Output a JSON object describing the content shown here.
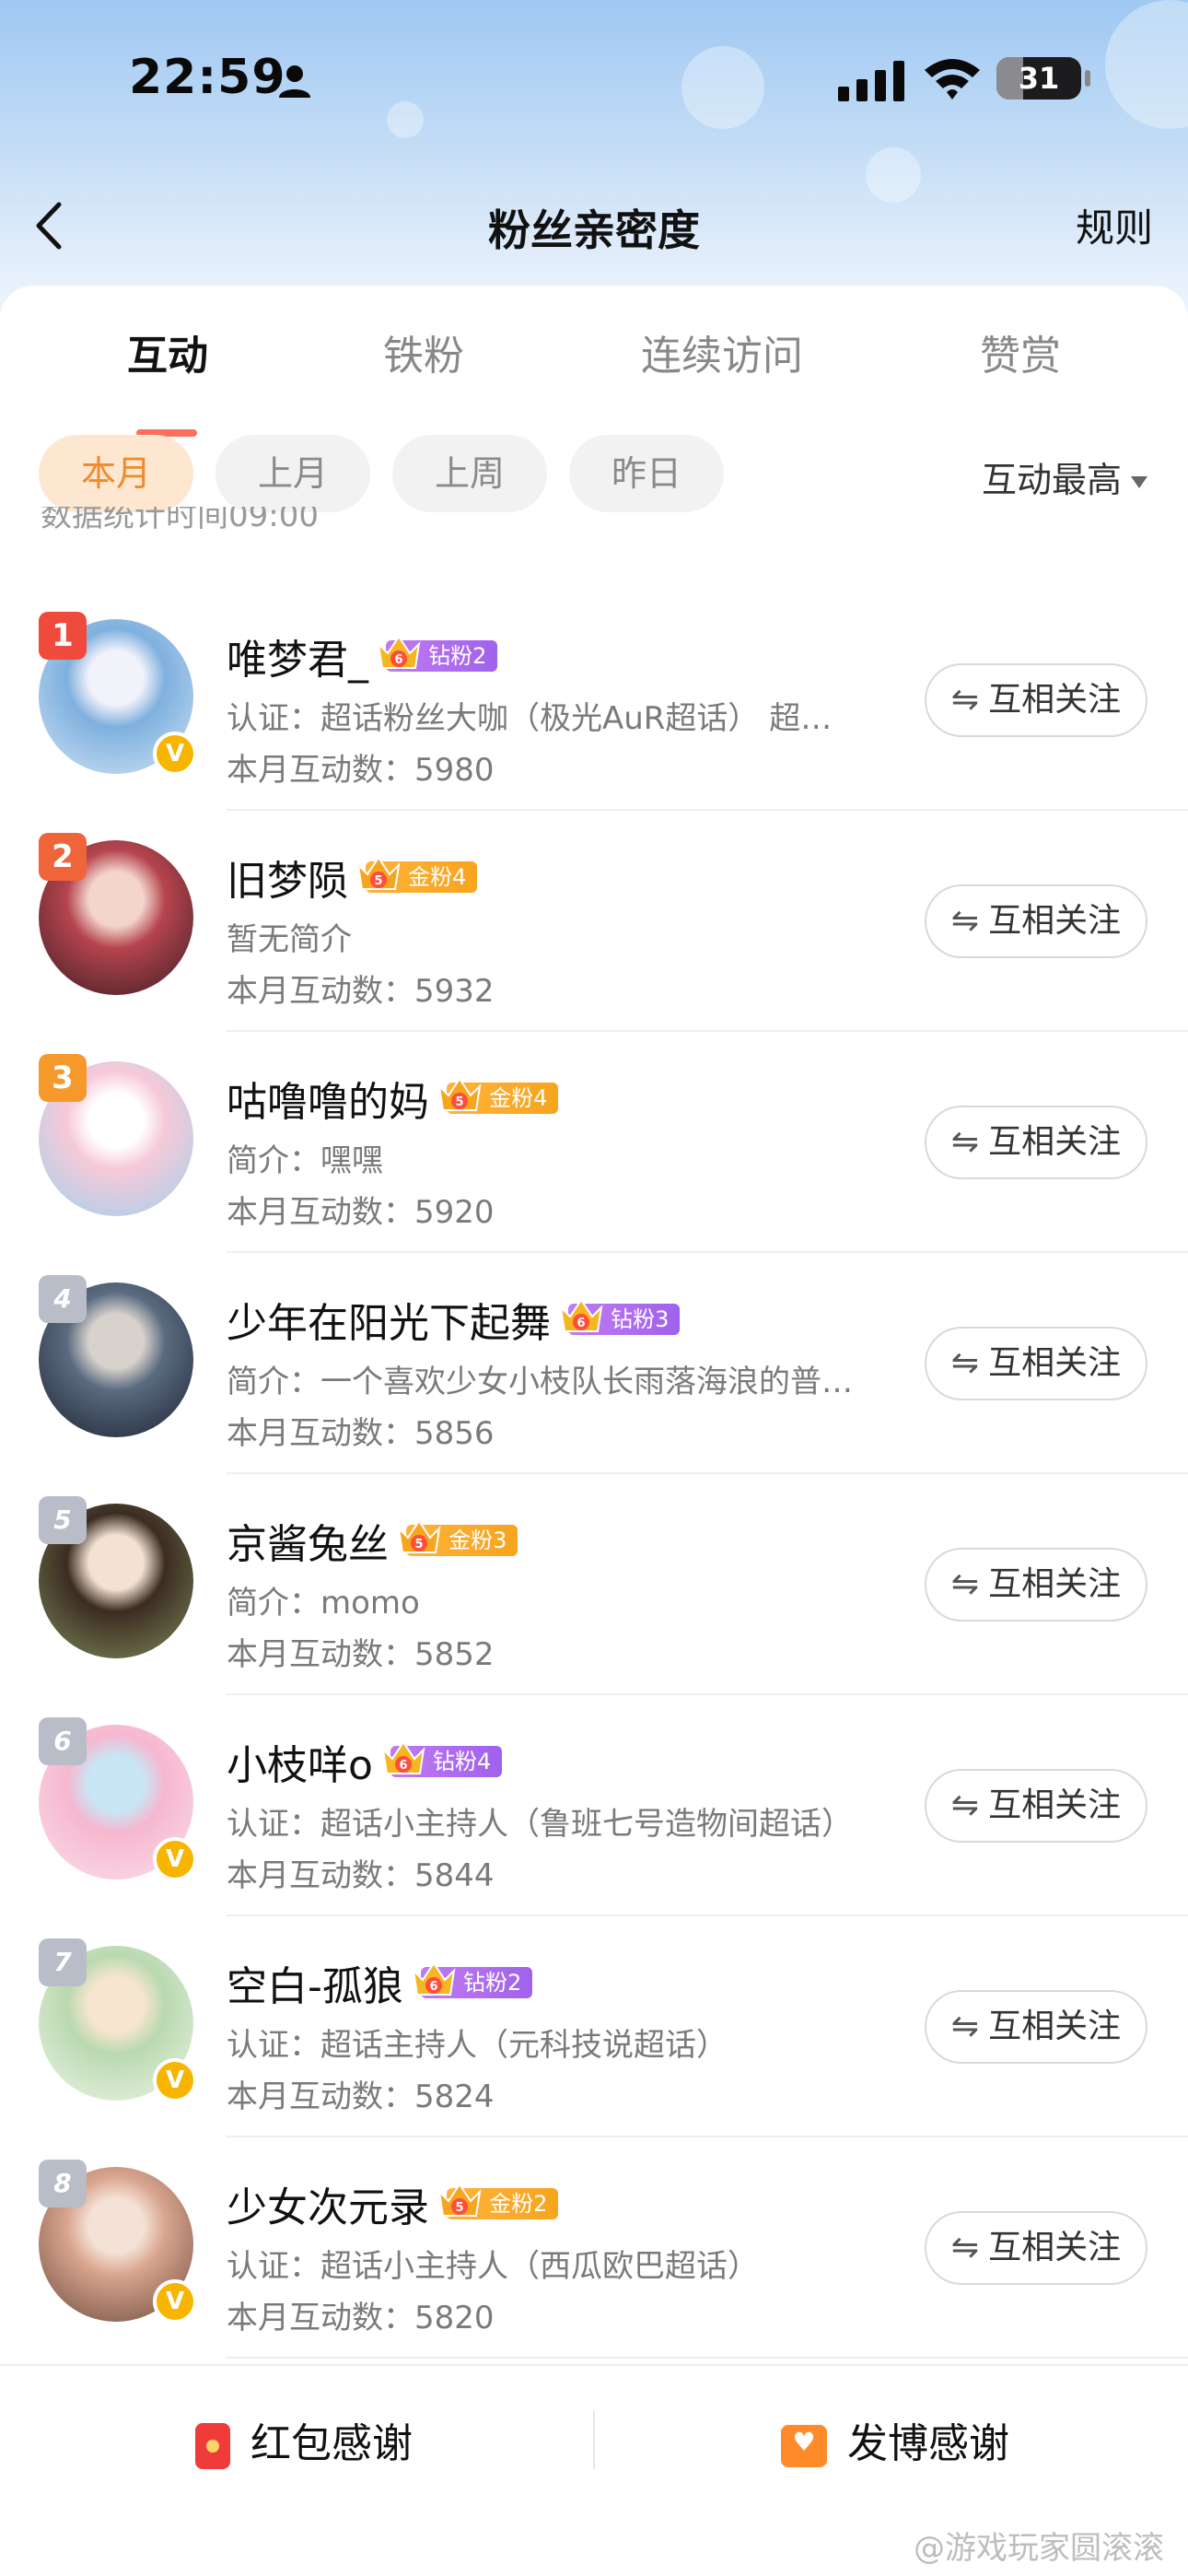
{
  "status": {
    "time": "22:59",
    "battery": "31",
    "battery_level": 0.31
  },
  "nav": {
    "title": "粉丝亲密度",
    "rules": "规则"
  },
  "tabs": [
    "互动",
    "铁粉",
    "连续访问",
    "赞赏"
  ],
  "filters": [
    "本月",
    "上月",
    "上周",
    "昨日"
  ],
  "sort_label": "互动最高",
  "cutoff_text": "数据统计时间09:00",
  "follow_label": "互相关注",
  "fans": [
    {
      "rank": "1",
      "name": "唯梦君_",
      "badge": "钻粉2",
      "badge_type": "diamond",
      "badge_level": "6",
      "desc": "认证：超话粉丝大咖（极光AuR超话） 超…",
      "count": "本月互动数：5980",
      "verified": true,
      "colors": [
        "#cfe3f5",
        "#7fb0de",
        "#f2f2fb"
      ]
    },
    {
      "rank": "2",
      "name": "旧梦陨",
      "badge": "金粉4",
      "badge_type": "gold",
      "badge_level": "5",
      "desc": "暂无简介",
      "count": "本月互动数：5932",
      "verified": false,
      "colors": [
        "#3a1d22",
        "#b5444e",
        "#f3d5cc"
      ]
    },
    {
      "rank": "3",
      "name": "咕噜噜的妈",
      "badge": "金粉4",
      "badge_type": "gold",
      "badge_level": "5",
      "desc": "简介：嘿嘿",
      "count": "本月互动数：5920",
      "verified": false,
      "colors": [
        "#9fd2ee",
        "#f6c9d8",
        "#ffffff"
      ]
    },
    {
      "rank": "4",
      "name": "少年在阳光下起舞",
      "badge": "钻粉3",
      "badge_type": "diamond",
      "badge_level": "6",
      "desc": "简介：一个喜欢少女小枝队长雨落海浪的普…",
      "count": "本月互动数：5856",
      "verified": false,
      "colors": [
        "#1c2230",
        "#5a6b80",
        "#d8d2cc"
      ]
    },
    {
      "rank": "5",
      "name": "京酱兔丝",
      "badge": "金粉3",
      "badge_type": "gold",
      "badge_level": "5",
      "desc": "简介：momo",
      "count": "本月互动数：5852",
      "verified": false,
      "colors": [
        "#7d8a5a",
        "#3b2c22",
        "#f3e1d2"
      ]
    },
    {
      "rank": "6",
      "name": "小枝咩o",
      "badge": "钻粉4",
      "badge_type": "diamond",
      "badge_level": "6",
      "desc": "认证：超话小主持人（鲁班七号造物间超话）",
      "count": "本月互动数：5844",
      "verified": true,
      "colors": [
        "#fbe0ea",
        "#f6b7cf",
        "#c9e6f6"
      ]
    },
    {
      "rank": "7",
      "name": "空白-孤狼",
      "badge": "钻粉2",
      "badge_type": "diamond",
      "badge_level": "6",
      "desc": "认证：超话主持人（元科技说超话）",
      "count": "本月互动数：5824",
      "verified": true,
      "colors": [
        "#eef4e6",
        "#b9d9b0",
        "#f7e6cf"
      ]
    },
    {
      "rank": "8",
      "name": "少女次元录",
      "badge": "金粉2",
      "badge_type": "gold",
      "badge_level": "5",
      "desc": "认证：超话小主持人（西瓜欧巴超话）",
      "count": "本月互动数：5820",
      "verified": true,
      "colors": [
        "#6a4a3c",
        "#d9a58e",
        "#f4e2d6"
      ]
    }
  ],
  "bottom": {
    "left": "红包感谢",
    "right": "发博感谢"
  },
  "watermark": "@游戏玩家圆滚滚"
}
